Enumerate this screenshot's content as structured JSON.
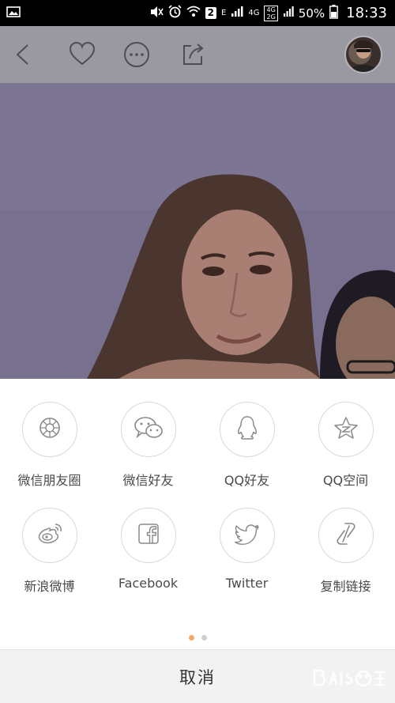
{
  "status_bar": {
    "notification_badge": "2",
    "signal_label": "E",
    "network_label": "4G",
    "network_stack_top": "4G",
    "network_stack_bottom": "2G",
    "battery_percent": "50%",
    "time": "18:33"
  },
  "toolbar": {
    "icons": [
      "back-icon",
      "heart-icon",
      "more-icon",
      "share-icon"
    ]
  },
  "share_sheet": {
    "items": [
      {
        "label": "微信朋友圈",
        "icon": "wechat-moments-icon"
      },
      {
        "label": "微信好友",
        "icon": "wechat-icon"
      },
      {
        "label": "QQ好友",
        "icon": "qq-icon"
      },
      {
        "label": "QQ空间",
        "icon": "qzone-icon"
      },
      {
        "label": "新浪微博",
        "icon": "weibo-icon"
      },
      {
        "label": "Facebook",
        "icon": "facebook-icon"
      },
      {
        "label": "Twitter",
        "icon": "twitter-icon"
      },
      {
        "label": "复制链接",
        "icon": "copy-link-icon"
      }
    ],
    "pager": {
      "page": 1,
      "pages": 2
    },
    "cancel_label": "取消"
  },
  "colors": {
    "active_dot": "#f5a867",
    "inactive_dot": "#cfcfcf",
    "icon_stroke": "#8a8a8a",
    "overlay": "#9a99a2"
  }
}
